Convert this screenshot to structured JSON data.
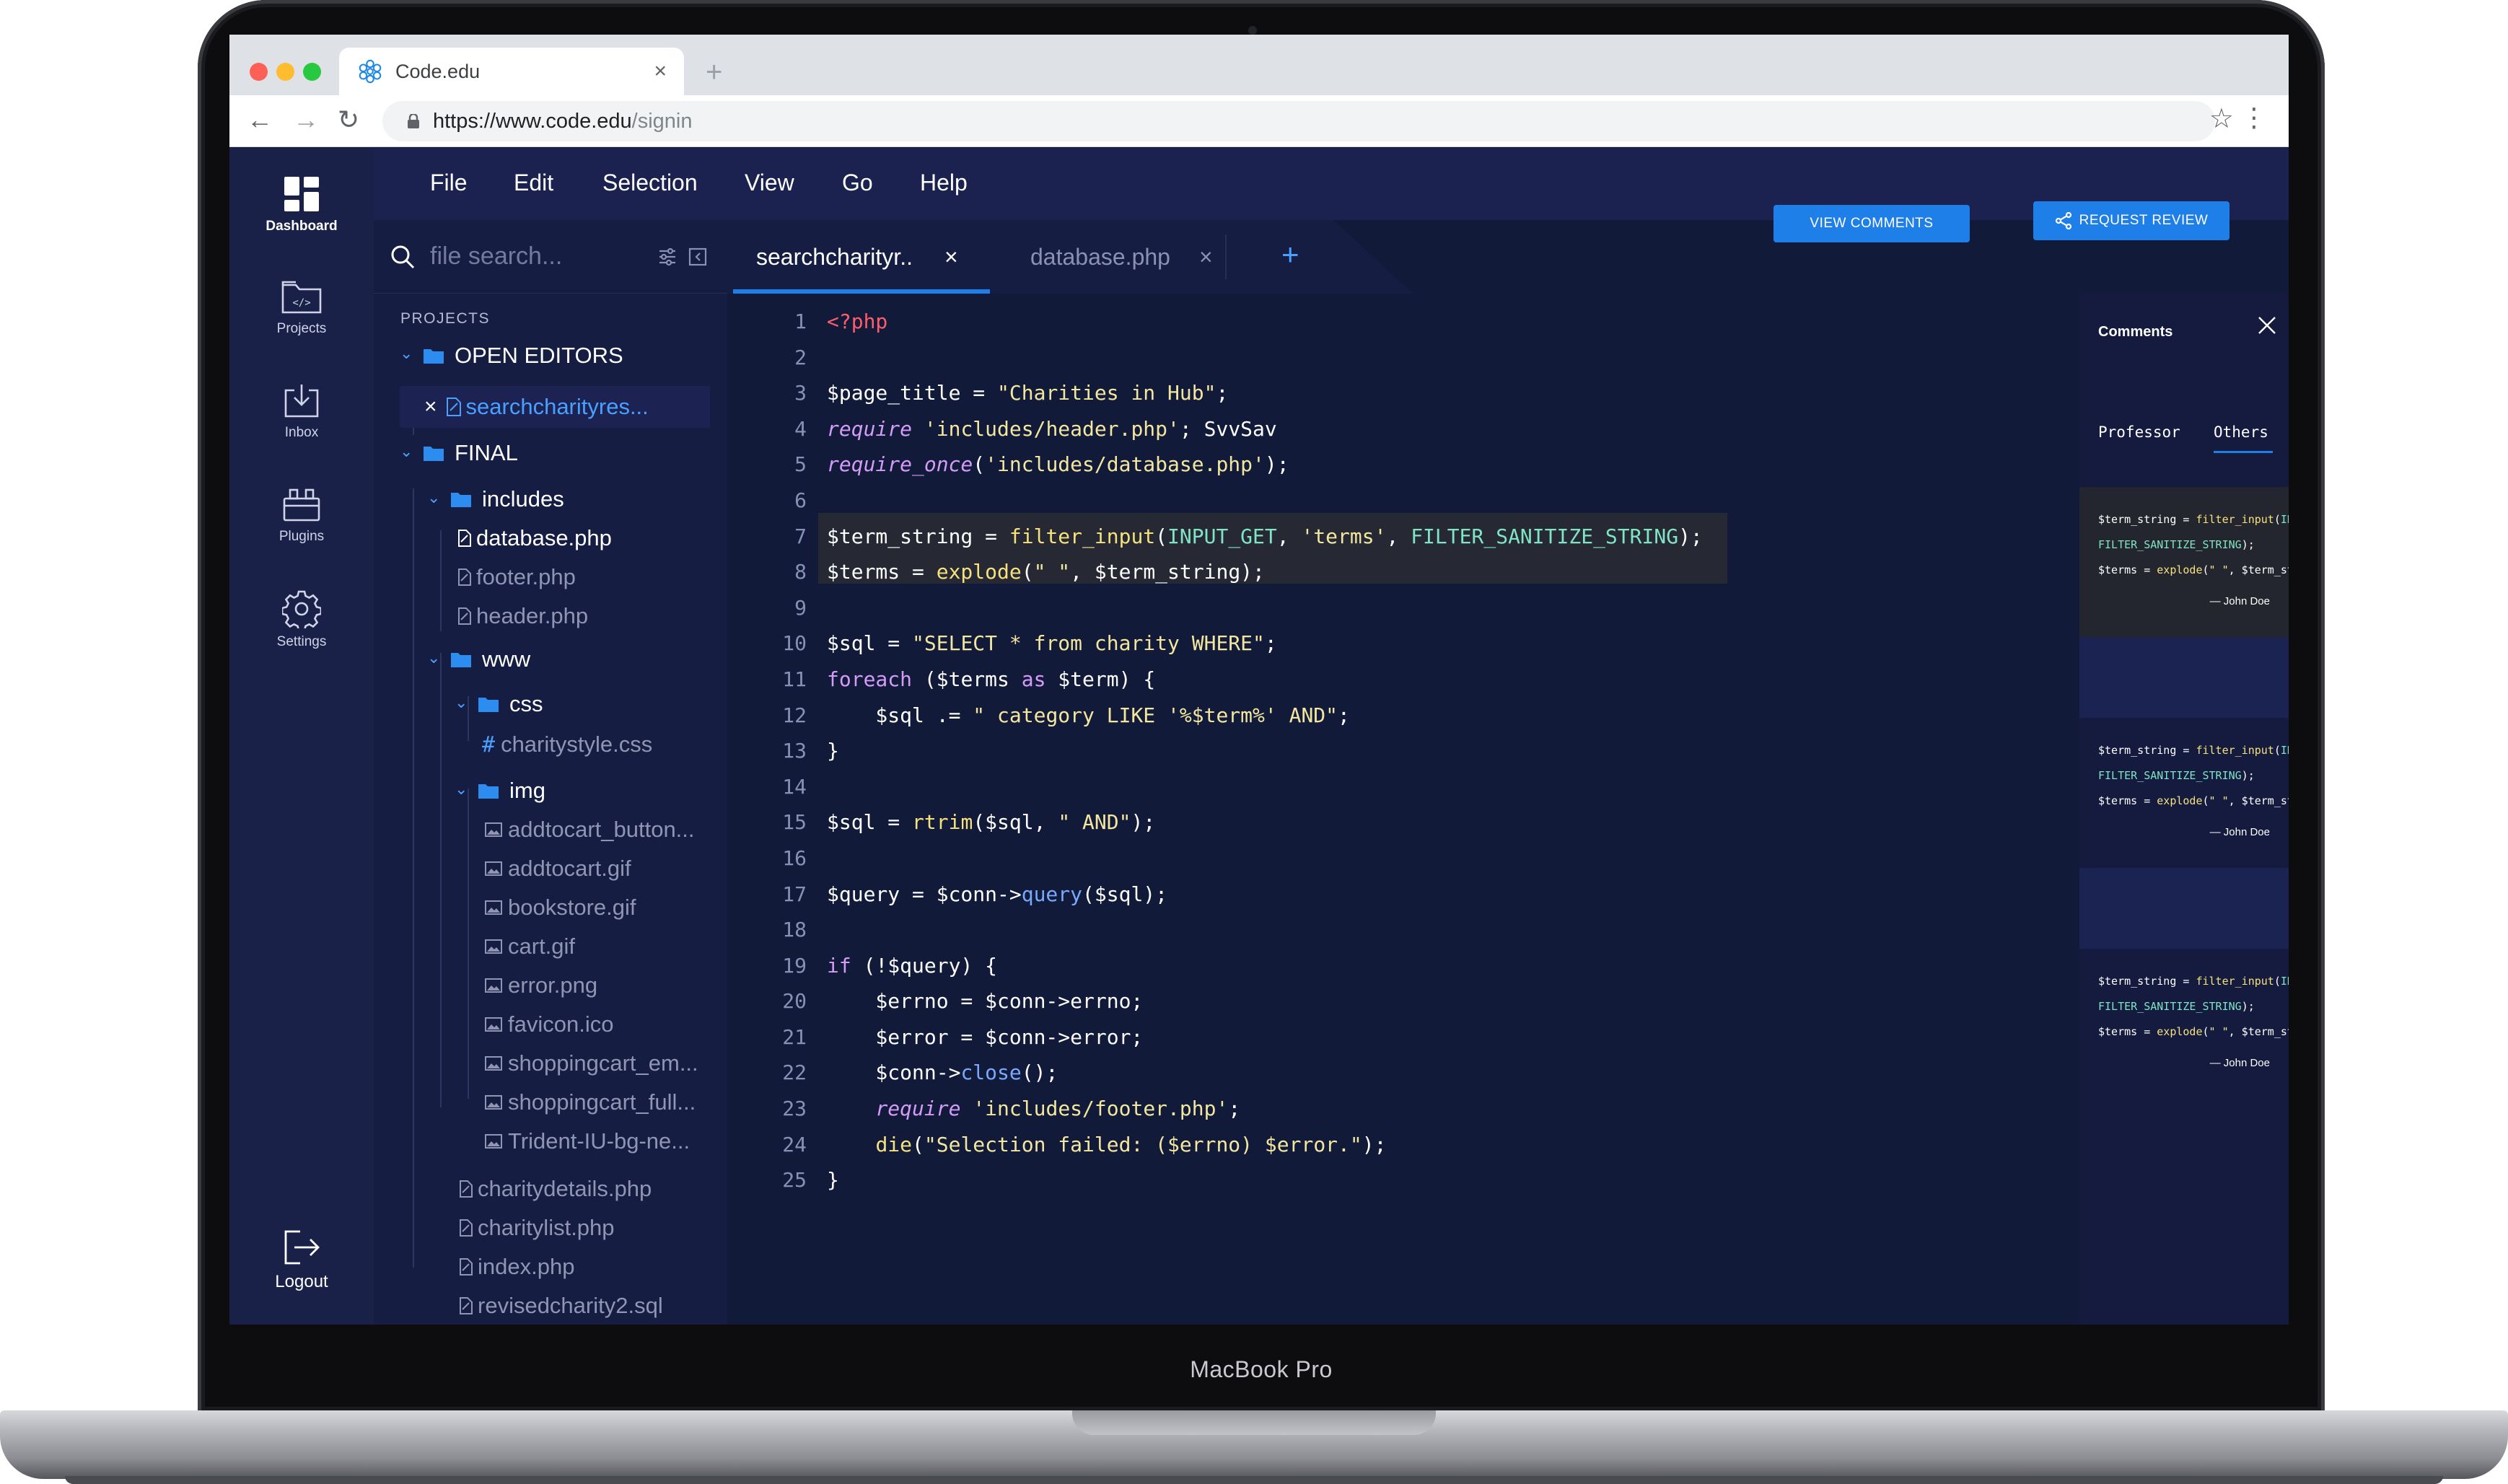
{
  "device": {
    "brand_label": "MacBook Pro"
  },
  "browser": {
    "tab_title": "Code.edu",
    "url_base": "https://www.code.edu",
    "url_path": "/signin"
  },
  "sidebar": {
    "items": [
      {
        "label": "Dashboard",
        "icon": "dashboard-icon"
      },
      {
        "label": "Projects",
        "icon": "folder-code-icon"
      },
      {
        "label": "Inbox",
        "icon": "inbox-icon"
      },
      {
        "label": "Plugins",
        "icon": "plugins-icon"
      },
      {
        "label": "Settings",
        "icon": "gear-icon"
      }
    ],
    "logout_label": "Logout"
  },
  "menu": {
    "items": [
      "File",
      "Edit",
      "Selection",
      "View",
      "Go",
      "Help"
    ]
  },
  "actions": {
    "view_comments": "VIEW COMMENTS",
    "request_review": "REQUEST REVIEW"
  },
  "explorer": {
    "search_placeholder": "file search...",
    "projects_label": "PROJECTS",
    "open_editors_label": "OPEN EDITORS",
    "open_editor_file": "searchcharityres...",
    "root_folder": "FINAL",
    "includes_folder": "includes",
    "includes_files": [
      "database.php",
      "footer.php",
      "header.php"
    ],
    "www_folder": "www",
    "css_folder": "css",
    "css_files": [
      "charitystyle.css"
    ],
    "img_folder": "img",
    "img_files": [
      "addtocart_button...",
      "addtocart.gif",
      "bookstore.gif",
      "cart.gif",
      "error.png",
      "favicon.ico",
      "shoppingcart_em...",
      "shoppingcart_full...",
      "Trident-IU-bg-ne..."
    ],
    "root_files": [
      "charitydetails.php",
      "charitylist.php",
      "index.php",
      "revisedcharity2.sql"
    ]
  },
  "editor": {
    "tabs": [
      {
        "label": "searchcharityr..",
        "active": true
      },
      {
        "label": "database.php",
        "active": false
      }
    ],
    "line_numbers": [
      "1",
      "2",
      "3",
      "4",
      "5",
      "6",
      "7",
      "8",
      "9",
      "10",
      "11",
      "12",
      "13",
      "14",
      "15",
      "16",
      "17",
      "18",
      "19",
      "20",
      "21",
      "22",
      "23",
      "24",
      "25"
    ],
    "code": [
      "<?php",
      "",
      "$page_title = \"Charities in Hub\";",
      "require 'includes/header.php'; SvvSav",
      "require_once('includes/database.php');",
      "",
      "$term_string = filter_input(INPUT_GET, 'terms', FILTER_SANITIZE_STRING);",
      "$terms = explode(\" \", $term_string);",
      "",
      "$sql = \"SELECT * from charity WHERE\";",
      "foreach ($terms as $term) {",
      "    $sql .= \" category LIKE '%$term%' AND\";",
      "}",
      "",
      "$sql = rtrim($sql, \" AND\");",
      "",
      "$query = $conn->query($sql);",
      "",
      "if (!$query) {",
      "    $errno = $conn->errno;",
      "    $error = $conn->error;",
      "    $conn->close();",
      "    require 'includes/footer.php';",
      "    die(\"Selection failed: ($errno) $error.\");",
      "}"
    ]
  },
  "comments": {
    "title": "Comments",
    "tabs": [
      {
        "label": "Professor",
        "active": false
      },
      {
        "label": "Others",
        "active": true
      }
    ],
    "items": [
      {
        "line1": "$term_string = filter_input(INPUT_GET, 'terms',",
        "line2": "FILTER_SANITIZE_STRING);",
        "line3": "$terms = explode(\" \", $term_string);",
        "author": "— John Doe"
      },
      {
        "line1": "$term_string = filter_input(INPUT_GET, 'terms',",
        "line2": "FILTER_SANITIZE_STRING);",
        "line3": "$terms = explode(\" \", $term_string);",
        "author": "— John Doe"
      },
      {
        "line1": "$term_string = filter_input(INPUT_GET, 'terms',",
        "line2": "FILTER_SANITIZE_STRING);",
        "line3": "$terms = explode(\" \", $term_string);",
        "author": "— John Doe"
      }
    ]
  },
  "colors": {
    "accent": "#1f7fe8",
    "app_bg": "#121a3a",
    "sidebar_bg": "#1a2148"
  }
}
